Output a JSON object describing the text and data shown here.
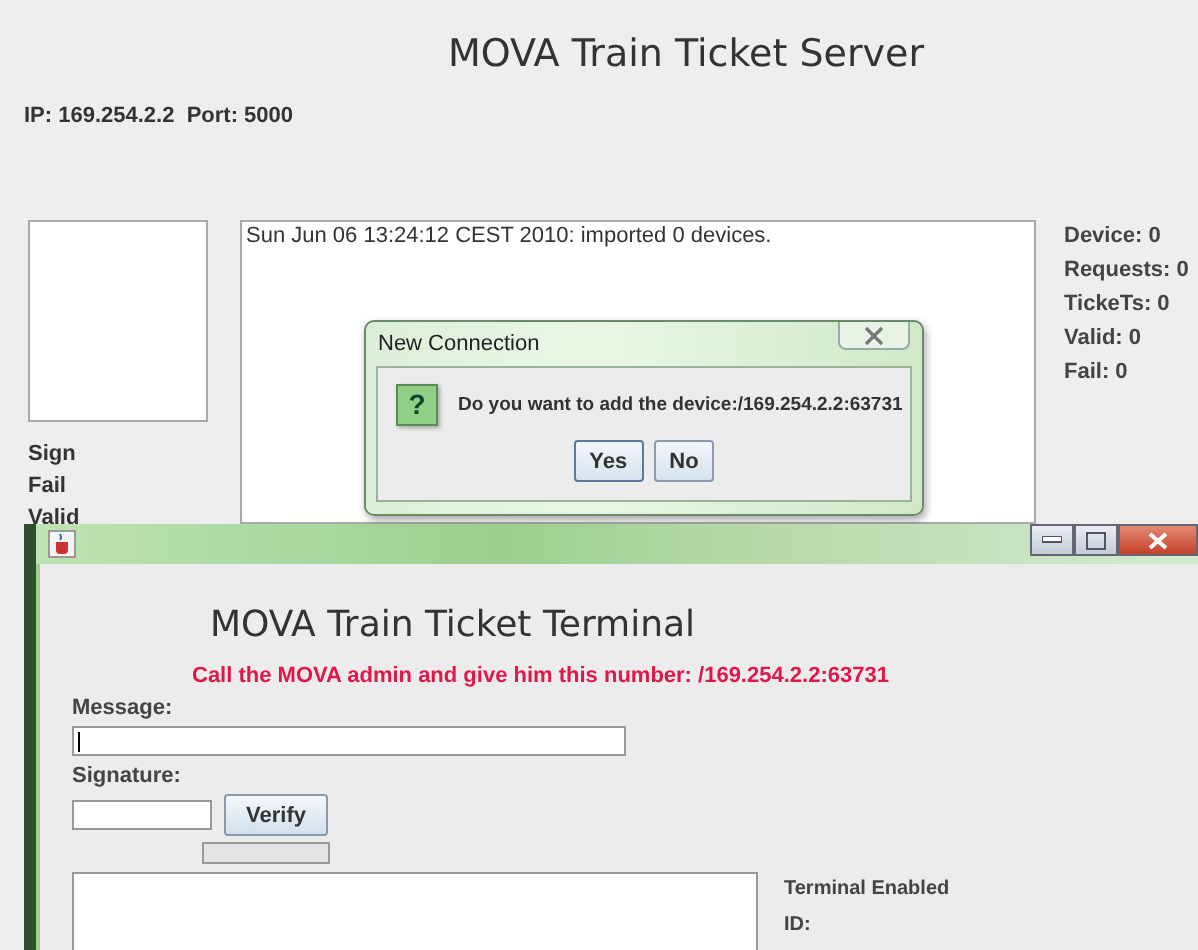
{
  "server": {
    "title": "MOVA Train Ticket Server",
    "address": "IP: 169.254.2.2  Port: 5000",
    "log": [
      "Sun Jun 06 13:24:12 CEST 2010: imported 0 devices."
    ],
    "stats": [
      "Device: 0",
      "Requests: 0",
      "TickeTs: 0",
      "Valid: 0",
      "Fail: 0"
    ],
    "labels": [
      "Sign",
      "Fail",
      "Valid"
    ]
  },
  "dialog": {
    "title": "New Connection",
    "icon": "?",
    "message": "Do you want to add the device:/169.254.2.2:63731",
    "buttons": [
      "Yes",
      "No"
    ]
  },
  "terminal": {
    "heading": "MOVA Train Ticket Terminal",
    "notice": "Call the MOVA admin and give him this number: /169.254.2.2:63731",
    "message_label": "Message:",
    "signature_label": "Signature:",
    "verify_button": "Verify",
    "progress": {
      "level": 0
    },
    "status": [
      "Terminal Enabled",
      "ID:"
    ]
  }
}
